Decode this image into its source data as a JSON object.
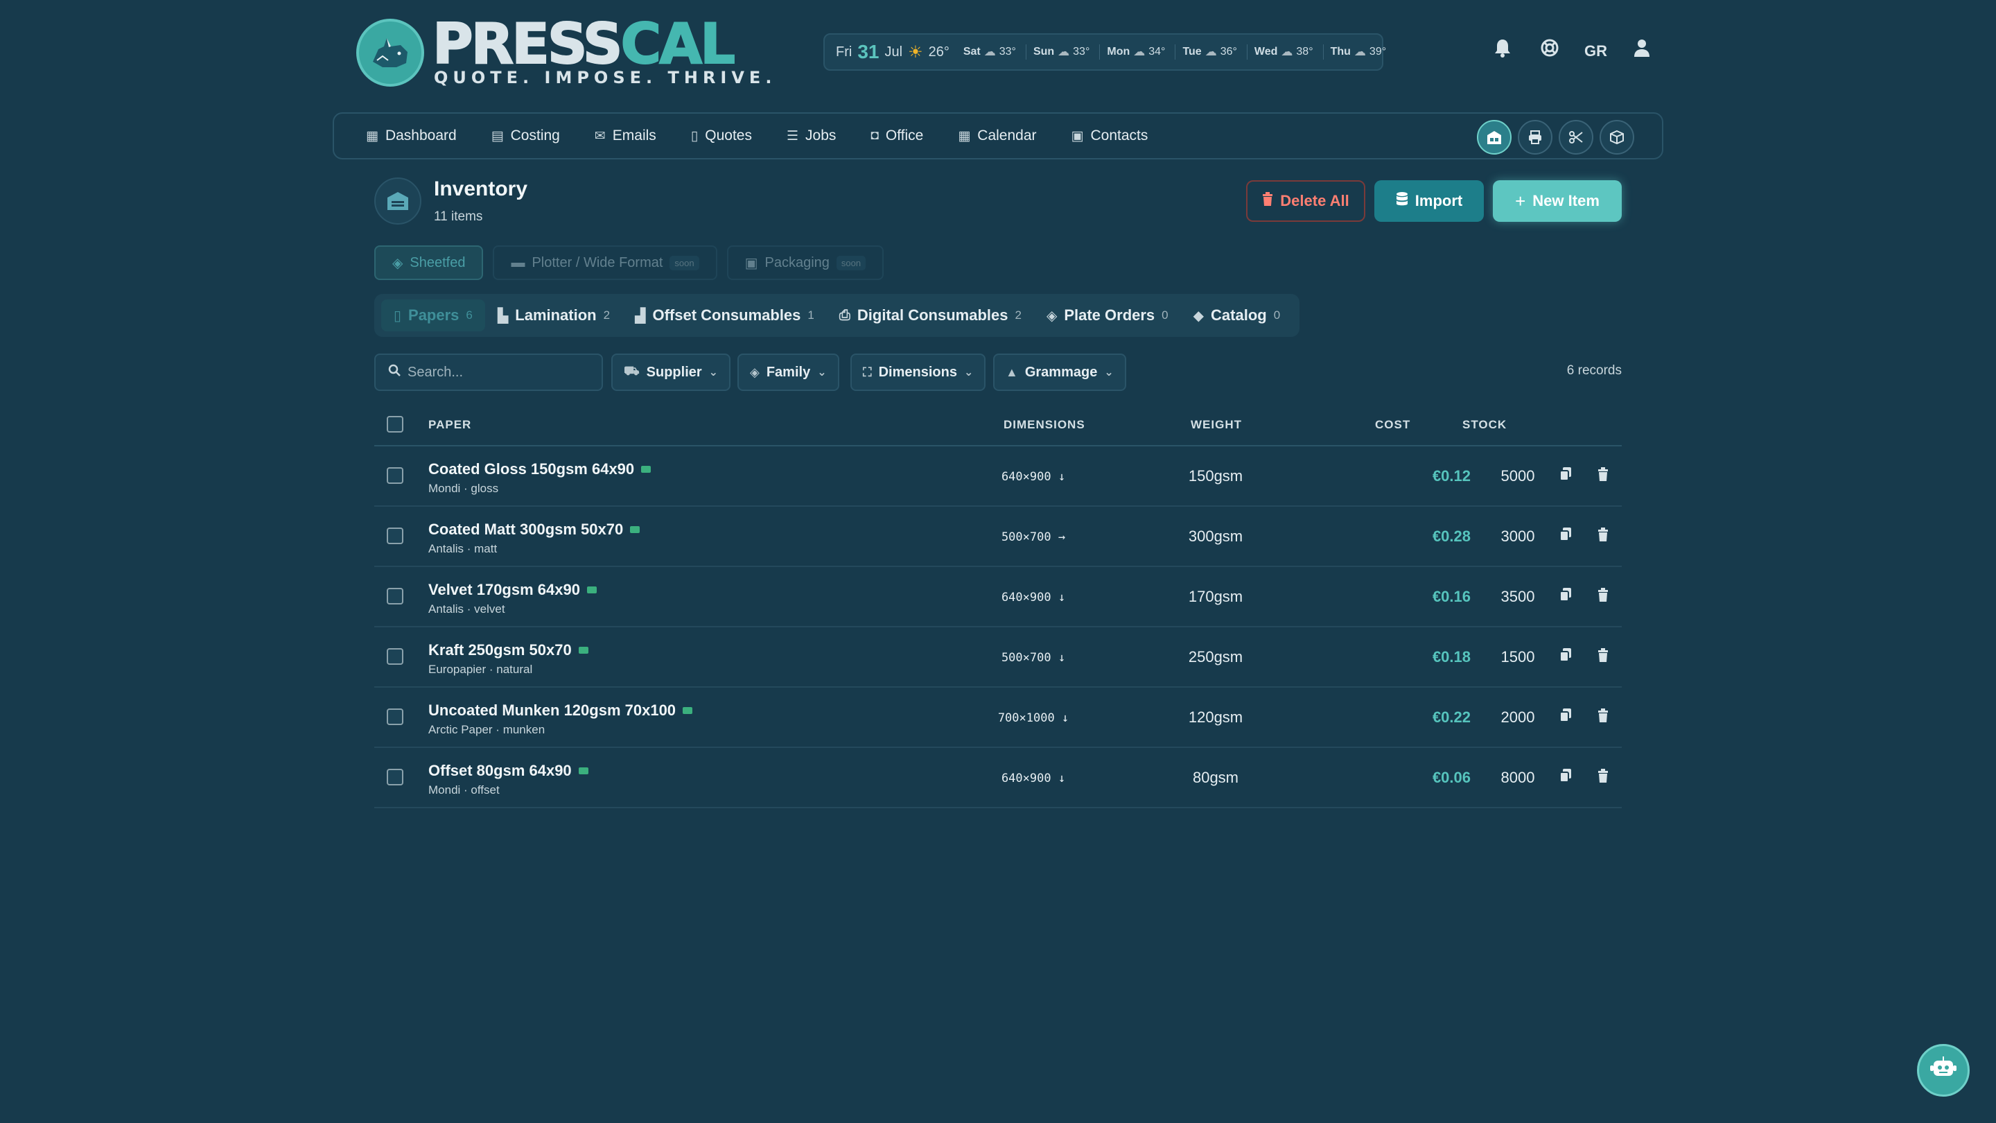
{
  "brand": {
    "name_main": "PRESS",
    "name_accent": "CAL",
    "tagline": "QUOTE. IMPOSE. THRIVE."
  },
  "weather": {
    "today": {
      "weekday": "Fri",
      "day": "31",
      "month": "Jul",
      "icon": "sun-icon",
      "temp": "26°"
    },
    "forecast": [
      {
        "day": "Sat",
        "icon": "cloud-sun-icon",
        "temp": "33°"
      },
      {
        "day": "Sun",
        "icon": "cloud-sun-icon",
        "temp": "33°"
      },
      {
        "day": "Mon",
        "icon": "cloud-sun-icon",
        "temp": "34°"
      },
      {
        "day": "Tue",
        "icon": "cloud-sun-icon",
        "temp": "36°"
      },
      {
        "day": "Wed",
        "icon": "cloud-sun-icon",
        "temp": "38°"
      },
      {
        "day": "Thu",
        "icon": "cloud-sun-icon",
        "temp": "39°"
      }
    ]
  },
  "header": {
    "language": "GR",
    "icons": [
      "bell-icon",
      "lifebuoy-icon",
      "user-icon"
    ]
  },
  "nav": {
    "items": [
      {
        "label": "Dashboard",
        "icon": "grid-icon"
      },
      {
        "label": "Costing",
        "icon": "calculator-icon"
      },
      {
        "label": "Emails",
        "icon": "envelope-icon"
      },
      {
        "label": "Quotes",
        "icon": "document-icon"
      },
      {
        "label": "Jobs",
        "icon": "list-icon"
      },
      {
        "label": "Office",
        "icon": "briefcase-icon"
      },
      {
        "label": "Calendar",
        "icon": "calendar-icon"
      },
      {
        "label": "Contacts",
        "icon": "address-book-icon"
      }
    ],
    "tools": [
      "warehouse-icon",
      "printer-icon",
      "scissors-icon",
      "box-icon"
    ]
  },
  "page": {
    "title": "Inventory",
    "subtitle": "11 items",
    "icon": "warehouse-icon",
    "buttons": {
      "delete_all": "Delete All",
      "import": "Import",
      "new_item": "New Item"
    }
  },
  "categories": [
    {
      "label": "Sheetfed",
      "icon": "layers-icon",
      "active": true,
      "badge": ""
    },
    {
      "label": "Plotter / Wide Format",
      "icon": "ruler-icon",
      "active": false,
      "badge": "soon"
    },
    {
      "label": "Packaging",
      "icon": "box-icon",
      "active": false,
      "badge": "soon"
    }
  ],
  "subtabs": [
    {
      "label": "Papers",
      "count": "6",
      "icon": "file-icon",
      "active": true
    },
    {
      "label": "Lamination",
      "count": "2",
      "icon": "roller-icon",
      "active": false
    },
    {
      "label": "Offset Consumables",
      "count": "1",
      "icon": "factory-icon",
      "active": false
    },
    {
      "label": "Digital Consumables",
      "count": "2",
      "icon": "printer-icon",
      "active": false
    },
    {
      "label": "Plate Orders",
      "count": "0",
      "icon": "layers-icon",
      "active": false
    },
    {
      "label": "Catalog",
      "count": "0",
      "icon": "tags-icon",
      "active": false
    }
  ],
  "filters": {
    "search_placeholder": "Search...",
    "dropdowns": [
      {
        "label": "Supplier",
        "icon": "truck-icon"
      },
      {
        "label": "Family",
        "icon": "layers-icon"
      },
      {
        "label": "Dimensions",
        "icon": "expand-icon"
      },
      {
        "label": "Grammage",
        "icon": "weight-icon"
      }
    ],
    "records": "6 records"
  },
  "table": {
    "columns": {
      "paper": "PAPER",
      "dimensions": "DIMENSIONS",
      "weight": "WEIGHT",
      "cost": "COST",
      "stock": "STOCK"
    },
    "rows": [
      {
        "name": "Coated Gloss 150gsm 64x90",
        "meta": "Mondi · gloss",
        "dimensions": "640×900 ↓",
        "weight": "150gsm",
        "cost": "€0.12",
        "stock": "5000"
      },
      {
        "name": "Coated Matt 300gsm 50x70",
        "meta": "Antalis · matt",
        "dimensions": "500×700 →",
        "weight": "300gsm",
        "cost": "€0.28",
        "stock": "3000"
      },
      {
        "name": "Velvet 170gsm 64x90",
        "meta": "Antalis · velvet",
        "dimensions": "640×900 ↓",
        "weight": "170gsm",
        "cost": "€0.16",
        "stock": "3500"
      },
      {
        "name": "Kraft 250gsm 50x70",
        "meta": "Europapier · natural",
        "dimensions": "500×700 ↓",
        "weight": "250gsm",
        "cost": "€0.18",
        "stock": "1500"
      },
      {
        "name": "Uncoated Munken 120gsm 70x100",
        "meta": "Arctic Paper · munken",
        "dimensions": "700×1000 ↓",
        "weight": "120gsm",
        "cost": "€0.22",
        "stock": "2000"
      },
      {
        "name": "Offset 80gsm 64x90",
        "meta": "Mondi · offset",
        "dimensions": "640×900 ↓",
        "weight": "80gsm",
        "cost": "€0.06",
        "stock": "8000"
      }
    ]
  },
  "colors": {
    "background": "#173a4c",
    "accent": "#56c4bd",
    "danger": "#ff7f72",
    "tag": "#3bb07e"
  },
  "fab": {
    "icon": "robot-icon"
  }
}
